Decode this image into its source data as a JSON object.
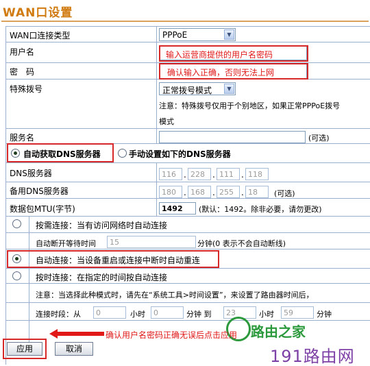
{
  "page": {
    "title": "WAN口设置"
  },
  "wan_type": {
    "label": "WAN口连接类型",
    "value": "PPPoE"
  },
  "username": {
    "label": "用户名",
    "annotation": "输入运营商提供的用户名密码"
  },
  "password": {
    "label": "密　码",
    "annotation": "确认输入正确，否则无法上网"
  },
  "special_dial": {
    "label": "特殊拨号",
    "value": "正常拨号模式",
    "note_line1": "注意：特殊拨号仅用于个别地区，如果正常PPPoE拨号",
    "note_line2": "模式"
  },
  "service_name": {
    "label": "服务名",
    "hint": "(可选)"
  },
  "dns_mode": {
    "auto_label": "自动获取DNS服务器",
    "manual_label": "手动设置如下的DNS服务器"
  },
  "dns_primary": {
    "label": "DNS服务器",
    "octets": [
      "116",
      "228",
      "111",
      "118"
    ]
  },
  "dns_secondary": {
    "label": "备用DNS服务器",
    "octets": [
      "180",
      "168",
      "255",
      "18"
    ],
    "hint": "(可选)"
  },
  "mtu": {
    "label": "数据包MTU(字节)",
    "value": "1492",
    "hint": "(默认：1492。除非必要，请勿更改)"
  },
  "connect_on_demand": {
    "label": "按需连接：当有访问网络时自动连接",
    "idle_label": "自动断开等待时间",
    "idle_value": "15",
    "idle_hint": "分钟(0 表示不会自动断线)"
  },
  "connect_auto": {
    "label": "自动连接：当设备重启或连接中断时自动重连"
  },
  "connect_timed": {
    "label": "按时连接：在指定的时间按自动连接",
    "note": "注意：当选择此种模式时，请先在“系统工具>时间设置”，来设置了路由器时间后，",
    "period_label": "连接时段：从",
    "from_hour": "0",
    "hour_unit": "小时",
    "from_min": "0",
    "min_to": "分钟  到",
    "to_hour": "23",
    "to_min": "59",
    "min_unit": "分钟"
  },
  "actions": {
    "apply_label": "应用",
    "cancel_label": "取消",
    "annotation": "确认用户名密码正确无误后点击应用"
  },
  "watermark": {
    "logo_text": "路由之家",
    "site_text": "191路由网"
  },
  "colors": {
    "title": "#d07a10",
    "annotation": "#e01818",
    "grid": "#9bb0cf"
  }
}
